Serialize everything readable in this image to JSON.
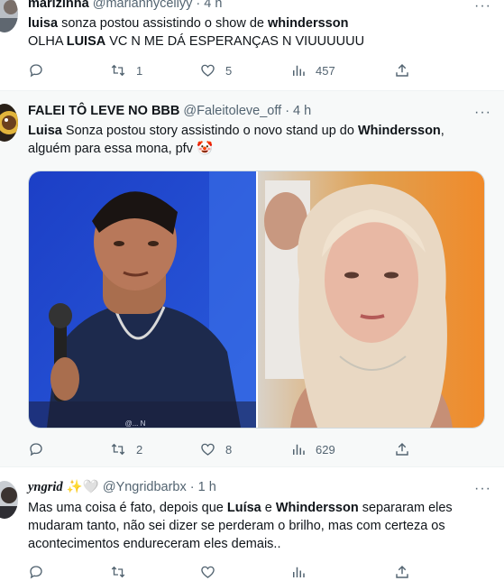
{
  "tweets": [
    {
      "display_name": "marizinha",
      "handle": "@mariannycellyy",
      "time": "· 4 h",
      "text_html": "<b>luisa</b> sonza postou assistindo o show de <b>whindersson</b><br>OLHA <b>LUISA</b> VC N ME DÁ ESPERANÇAS N VIUUUUUU",
      "replies": "",
      "retweets": "1",
      "likes": "5",
      "views": "457"
    },
    {
      "display_name": "FALEI TÔ LEVE NO BBB",
      "handle": "@Faleitoleve_off",
      "time": "· 4 h",
      "text_html": "<b>Luisa</b> Sonza postou story assistindo o novo stand up do <b>Whindersson</b>,<br>alguém para essa mona, pfv 🤡",
      "media_caption": "@... N",
      "replies": "",
      "retweets": "2",
      "likes": "8",
      "views": "629"
    },
    {
      "display_name": "yngrid",
      "name_emoji": "✨🤍",
      "handle": "@Yngridbarbx",
      "time": "· 1 h",
      "text_html": "Mas uma coisa é fato, depois que <b>Luísa</b> e <b>Whindersson</b> separaram eles<br>mudaram tanto, não sei dizer se perderam o brilho, mas com certeza os<br>acontecimentos endureceram eles demais..",
      "replies": "",
      "retweets": "",
      "likes": "",
      "views": ""
    }
  ],
  "more_glyph": "···",
  "colors": {
    "text": "#0f1419",
    "muted": "#536471",
    "divider": "#eff3f4",
    "hover_bg": "#f7f9f9"
  }
}
